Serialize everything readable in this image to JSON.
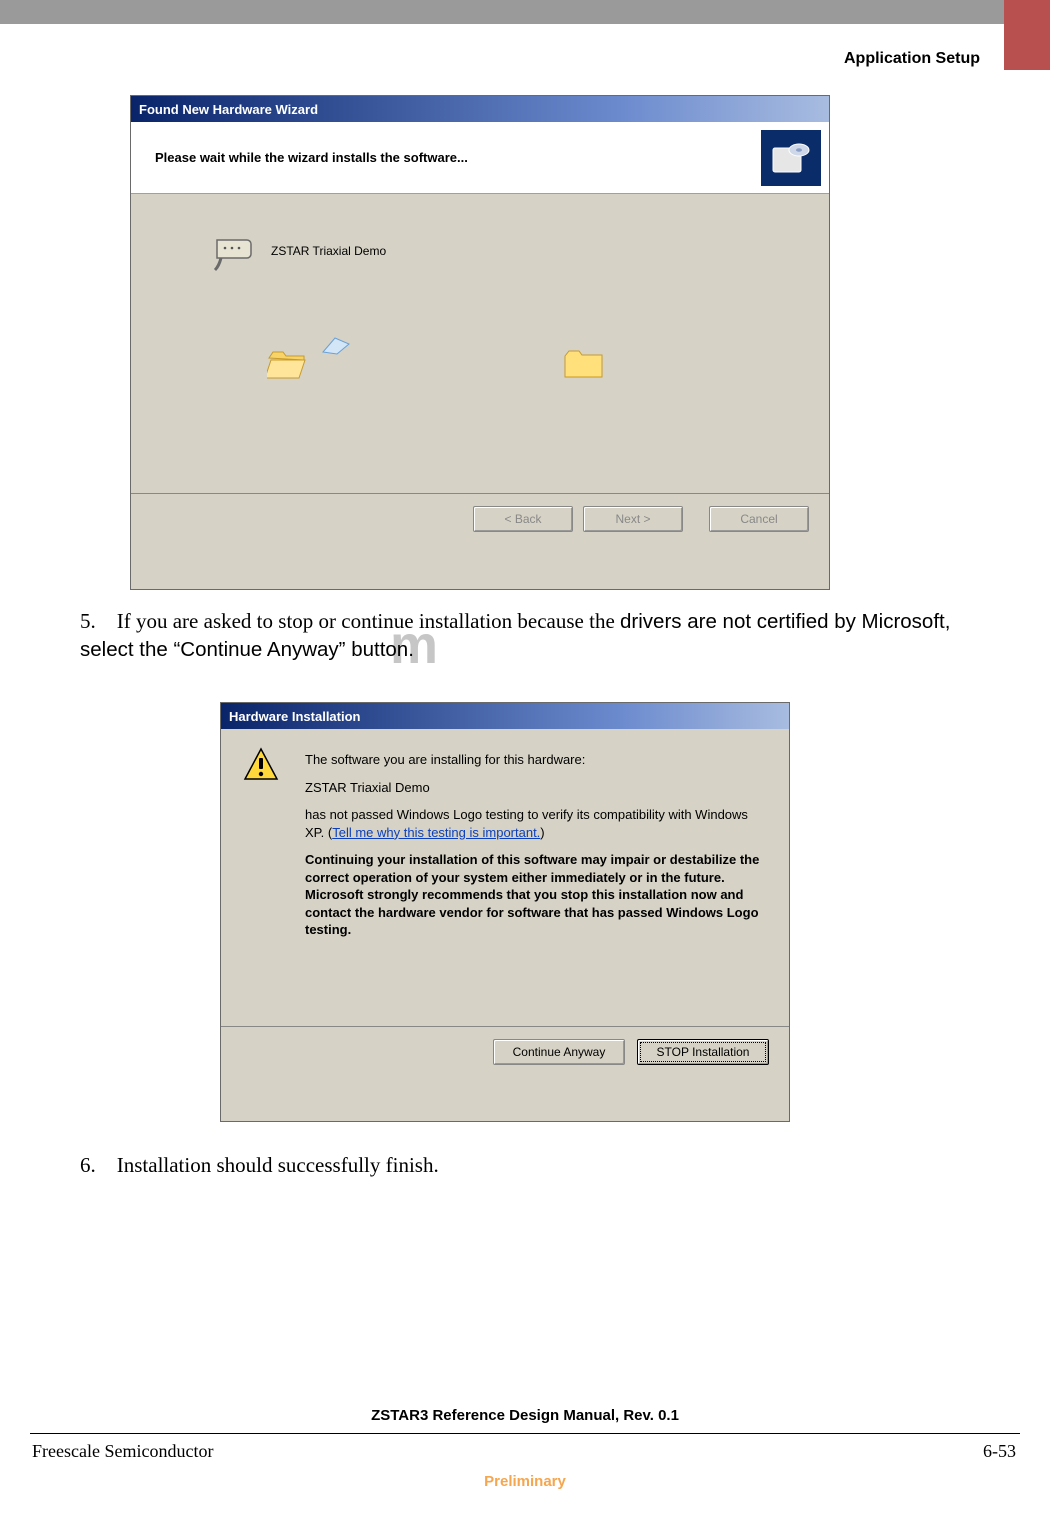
{
  "page": {
    "section_header": "Application Setup",
    "footer_title": "ZSTAR3 Reference Design Manual, Rev. 0.1",
    "footer_left": "Freescale Semiconductor",
    "footer_right": "6-53",
    "footer_prelim": "Preliminary"
  },
  "instructions": {
    "step5_num": "5.",
    "step5_a": "If you are asked to stop or continue installation because the ",
    "step5_b": "drivers are not certified by Microsoft, select the “Continue Anyway” button.",
    "step6_num": "6.",
    "step6": "Installation should successfully finish."
  },
  "wizard": {
    "title": "Found New Hardware Wizard",
    "heading": "Please wait while the wizard installs the software...",
    "device_name": "ZSTAR Triaxial Demo",
    "buttons": {
      "back": "< Back",
      "next": "Next >",
      "cancel": "Cancel"
    }
  },
  "warning_dialog": {
    "title": "Hardware Installation",
    "line1": "The software you are installing for this hardware:",
    "device": "ZSTAR Triaxial Demo",
    "line2a": "has not passed Windows Logo testing to verify its compatibility with Windows XP. (",
    "link": "Tell me why this testing is important.",
    "line2b": ")",
    "bold_block": "Continuing your installation of this software may impair or destabilize the correct operation of your system either immediately or in the future. Microsoft strongly recommends that you stop this installation now and contact the hardware vendor for software that has passed Windows Logo testing.",
    "buttons": {
      "continue": "Continue Anyway",
      "stop": "STOP Installation"
    }
  },
  "watermark": "m"
}
